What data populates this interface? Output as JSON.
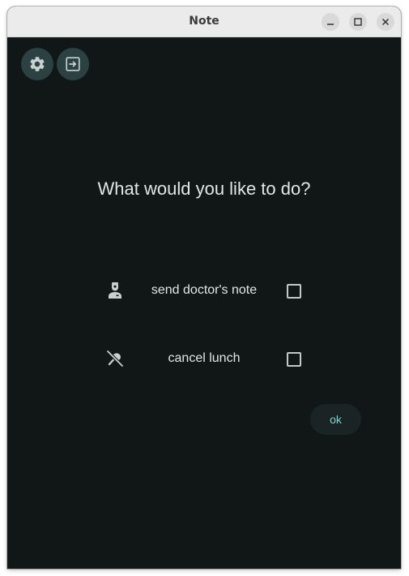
{
  "window": {
    "title": "Note",
    "controls": {
      "minimize_icon": "minimize-icon",
      "maximize_icon": "maximize-icon",
      "close_icon": "close-icon"
    }
  },
  "toolbar": {
    "settings_icon": "gear-icon",
    "exit_icon": "exit-icon"
  },
  "main": {
    "question": "What would you like to do?",
    "options": [
      {
        "icon": "doctor-icon",
        "label": "send doctor's note",
        "checked": false
      },
      {
        "icon": "no-food-icon",
        "label": "cancel lunch",
        "checked": false
      }
    ],
    "ok_label": "ok"
  },
  "colors": {
    "background": "#111717",
    "fab_background": "#2c4242",
    "accent_text": "#7fd3cf",
    "titlebar": "#ebebeb"
  }
}
